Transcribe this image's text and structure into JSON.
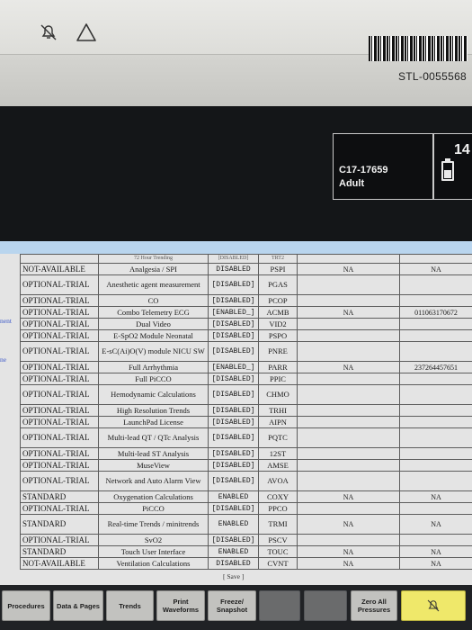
{
  "device": {
    "asset_tag": "STL-0055568",
    "alarm_pause_icon": "alarm-bell-off-icon",
    "warning_icon": "warning-triangle-icon"
  },
  "patient": {
    "id": "C17-17659",
    "type": "Adult",
    "top_value": "14"
  },
  "left_stubs": [
    "nent",
    "ne"
  ],
  "licenses": {
    "header_row": [
      "",
      "72 Hour Trending",
      "[DISABLED]",
      "TRT2"
    ],
    "rows": [
      {
        "status": "NOT-AVAILABLE",
        "feature": "Analgesia / SPI",
        "state": "DISABLED",
        "code": "PSPI",
        "v1": "NA",
        "v2": "NA"
      },
      {
        "status": "OPTIONAL-TRIAL",
        "feature": "Anesthetic agent measurement",
        "state": "[DISABLED]",
        "code": "PGAS",
        "v1": "",
        "v2": ""
      },
      {
        "status": "OPTIONAL-TRIAL",
        "feature": "CO",
        "state": "[DISABLED]",
        "code": "PCOP",
        "v1": "",
        "v2": ""
      },
      {
        "status": "OPTIONAL-TRIAL",
        "feature": "Combo Telemetry ECG",
        "state": "[ENABLED_]",
        "code": "ACMB",
        "v1": "NA",
        "v2": "011063170672"
      },
      {
        "status": "OPTIONAL-TRIAL",
        "feature": "Dual Video",
        "state": "[DISABLED]",
        "code": "VID2",
        "v1": "",
        "v2": ""
      },
      {
        "status": "OPTIONAL-TRIAL",
        "feature": "E-SpO2 Module Neonatal",
        "state": "[DISABLED]",
        "code": "PSPO",
        "v1": "",
        "v2": ""
      },
      {
        "status": "OPTIONAL-TRIAL",
        "feature": "E-sC(Ai)O(V) module NICU SW",
        "state": "[DISABLED]",
        "code": "PNRE",
        "v1": "",
        "v2": ""
      },
      {
        "status": "OPTIONAL-TRIAL",
        "feature": "Full Arrhythmia",
        "state": "[ENABLED_]",
        "code": "PARR",
        "v1": "NA",
        "v2": "237264457651"
      },
      {
        "status": "OPTIONAL-TRIAL",
        "feature": "Full PiCCO",
        "state": "[DISABLED]",
        "code": "PPIC",
        "v1": "",
        "v2": ""
      },
      {
        "status": "OPTIONAL-TRIAL",
        "feature": "Hemodynamic Calculations",
        "state": "[DISABLED]",
        "code": "CHMO",
        "v1": "",
        "v2": ""
      },
      {
        "status": "OPTIONAL-TRIAL",
        "feature": "High Resolution Trends",
        "state": "[DISABLED]",
        "code": "TRHI",
        "v1": "",
        "v2": ""
      },
      {
        "status": "OPTIONAL-TRIAL",
        "feature": "LaunchPad License",
        "state": "[DISABLED]",
        "code": "AIPN",
        "v1": "",
        "v2": ""
      },
      {
        "status": "OPTIONAL-TRIAL",
        "feature": "Multi-lead QT / QTc Analysis",
        "state": "[DISABLED]",
        "code": "PQTC",
        "v1": "",
        "v2": ""
      },
      {
        "status": "OPTIONAL-TRIAL",
        "feature": "Multi-lead ST Analysis",
        "state": "[DISABLED]",
        "code": "12ST",
        "v1": "",
        "v2": ""
      },
      {
        "status": "OPTIONAL-TRIAL",
        "feature": "MuseView",
        "state": "[DISABLED]",
        "code": "AMSE",
        "v1": "",
        "v2": ""
      },
      {
        "status": "OPTIONAL-TRIAL",
        "feature": "Network and Auto Alarm View",
        "state": "[DISABLED]",
        "code": "AVOA",
        "v1": "",
        "v2": ""
      },
      {
        "status": "STANDARD",
        "feature": "Oxygenation Calculations",
        "state": "ENABLED",
        "code": "COXY",
        "v1": "NA",
        "v2": "NA"
      },
      {
        "status": "OPTIONAL-TRIAL",
        "feature": "PiCCO",
        "state": "[DISABLED]",
        "code": "PPCO",
        "v1": "",
        "v2": ""
      },
      {
        "status": "STANDARD",
        "feature": "Real-time Trends / minitrends",
        "state": "ENABLED",
        "code": "TRMI",
        "v1": "NA",
        "v2": "NA"
      },
      {
        "status": "OPTIONAL-TRIAL",
        "feature": "SvO2",
        "state": "[DISABLED]",
        "code": "PSCV",
        "v1": "",
        "v2": ""
      },
      {
        "status": "STANDARD",
        "feature": "Touch User Interface",
        "state": "ENABLED",
        "code": "TOUC",
        "v1": "NA",
        "v2": "NA"
      },
      {
        "status": "NOT-AVAILABLE",
        "feature": "Ventilation Calculations",
        "state": "DISABLED",
        "code": "CVNT",
        "v1": "NA",
        "v2": "NA"
      }
    ],
    "save_label": "[ Save ]"
  },
  "buttons": [
    {
      "label": "Procedures",
      "enabled": true
    },
    {
      "label": "Data & Pages",
      "enabled": true
    },
    {
      "label": "Trends",
      "enabled": true
    },
    {
      "label": "Print Waveforms",
      "enabled": true
    },
    {
      "label": "Freeze/ Snapshot",
      "enabled": true
    },
    {
      "label": "",
      "enabled": false
    },
    {
      "label": "",
      "enabled": false
    },
    {
      "label": "Zero All Pressures",
      "enabled": true
    },
    {
      "label": "",
      "icon": "alarm-audio-pause-icon",
      "enabled": true
    }
  ],
  "colors": {
    "panel_header": "#b9d5ee",
    "alarm_button": "#efe86a",
    "link_blue": "#3b57c9"
  }
}
